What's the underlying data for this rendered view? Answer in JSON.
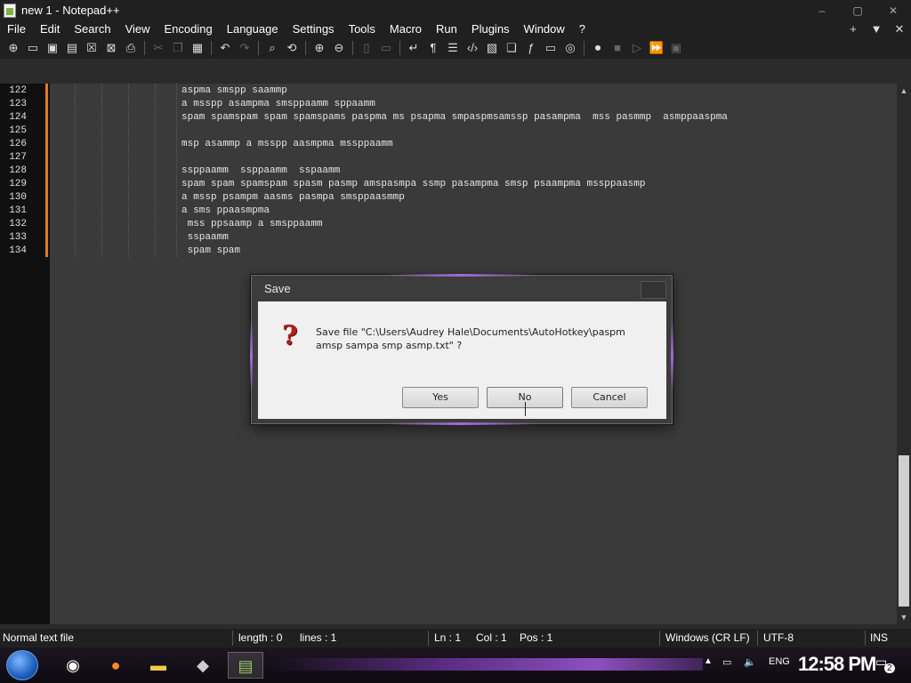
{
  "window": {
    "title": "new 1 - Notepad++",
    "controls": [
      "–",
      "▢",
      "✕"
    ]
  },
  "menu": {
    "items": [
      "File",
      "Edit",
      "Search",
      "View",
      "Encoding",
      "Language",
      "Settings",
      "Tools",
      "Macro",
      "Run",
      "Plugins",
      "Window",
      "?"
    ],
    "right": [
      "+",
      "▼",
      "✕"
    ]
  },
  "editor": {
    "lines": [
      {
        "no": "122",
        "text": "aspma smspp saammp"
      },
      {
        "no": "123",
        "text": "a msspp asampma smsppaamm sppaamm"
      },
      {
        "no": "124",
        "text": "spam spamspam spam spamspams paspma ms psapma smpaspmsamssp pasampma  mss pasmmp  asmppaaspma"
      },
      {
        "no": "125",
        "text": ""
      },
      {
        "no": "126",
        "text": "msp asammp a msspp aasmpma mssppaamm"
      },
      {
        "no": "127",
        "text": ""
      },
      {
        "no": "128",
        "text": "ssppaamm  ssppaamm  sspaamm"
      },
      {
        "no": "129",
        "text": "spam spam spamspam spasm pasmp amspasmpa ssmp pasampma smsp psaampma mssppaasmp"
      },
      {
        "no": "130",
        "text": "a mssp psampm aasms pasmpa smsppaasmmp"
      },
      {
        "no": "131",
        "text": "a sms ppaasmpma"
      },
      {
        "no": "132",
        "text": " mss ppsaamp a smsppaamm"
      },
      {
        "no": "133",
        "text": " sspaamm"
      },
      {
        "no": "134",
        "text": " spam spam"
      }
    ]
  },
  "statusbar": {
    "filetype": "Normal text file",
    "length": "length : 0",
    "lines": "lines : 1",
    "ln": "Ln : 1",
    "col": "Col : 1",
    "pos": "Pos : 1",
    "eol": "Windows (CR LF)",
    "encoding": "UTF-8",
    "mode": "INS"
  },
  "dialog": {
    "title": "Save",
    "message": "Save file \"C:\\Users\\Audrey Hale\\Documents\\AutoHotkey\\paspm amsp sampa smp asmp.txt\" ?",
    "buttons": {
      "yes": "Yes",
      "no": "No",
      "cancel": "Cancel"
    }
  },
  "taskbar": {
    "lang": "ENG",
    "time": "12:58 PM",
    "notification_count": "2"
  }
}
